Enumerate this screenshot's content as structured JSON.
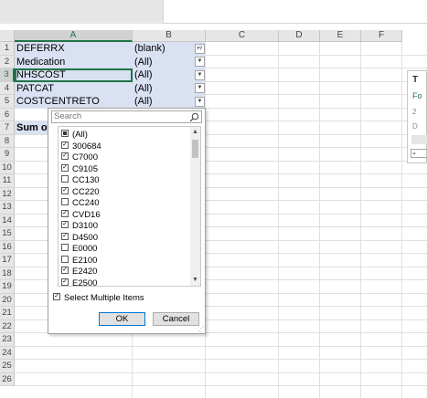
{
  "columns": [
    "A",
    "B",
    "C",
    "D",
    "E",
    "F"
  ],
  "rows": [
    "1",
    "2",
    "3",
    "4",
    "5",
    "6",
    "7",
    "8",
    "9",
    "10",
    "11",
    "12",
    "13",
    "14",
    "15",
    "16",
    "17",
    "18",
    "19",
    "20",
    "21",
    "22",
    "23",
    "24",
    "25",
    "26"
  ],
  "pivot_filters": [
    {
      "field": "DEFERRX",
      "value": "(blank)"
    },
    {
      "field": "Medication",
      "value": "(All)"
    },
    {
      "field": "NHSCOST",
      "value": "(All)"
    },
    {
      "field": "PATCAT",
      "value": "(All)"
    },
    {
      "field": "COSTCENTRETO",
      "value": "(All)"
    }
  ],
  "sum_label": "Sum of",
  "filter_panel": {
    "search_placeholder": "Search",
    "items": [
      {
        "label": "(All)",
        "state": "partial"
      },
      {
        "label": "300684",
        "state": "checked"
      },
      {
        "label": "C7000",
        "state": "checked"
      },
      {
        "label": "C9105",
        "state": "checked"
      },
      {
        "label": "CC130",
        "state": "unchecked"
      },
      {
        "label": "CC220",
        "state": "checked"
      },
      {
        "label": "CC240",
        "state": "unchecked"
      },
      {
        "label": "CVD16",
        "state": "checked"
      },
      {
        "label": "D3100",
        "state": "checked"
      },
      {
        "label": "D4500",
        "state": "checked"
      },
      {
        "label": "E0000",
        "state": "unchecked"
      },
      {
        "label": "E2100",
        "state": "unchecked"
      },
      {
        "label": "E2420",
        "state": "checked"
      },
      {
        "label": "E2500",
        "state": "checked"
      }
    ],
    "select_multiple_label": "Select Multiple Items",
    "ok_label": "OK",
    "cancel_label": "Cancel"
  },
  "side_panel": {
    "title": "T",
    "link": "Fo",
    "line1": "2",
    "line2": "D"
  },
  "colors": {
    "pivot_fill": "#d9e1f2",
    "selection": "#217346",
    "header_fill": "#e6e6e6"
  }
}
